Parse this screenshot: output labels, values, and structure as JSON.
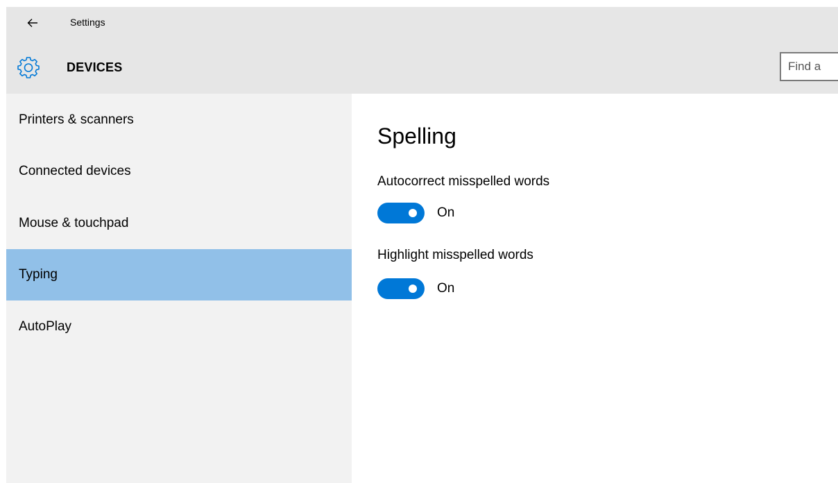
{
  "window": {
    "title": "Settings",
    "back_icon": "back-arrow-icon"
  },
  "header": {
    "icon": "gear-icon",
    "title": "DEVICES",
    "search": {
      "placeholder": "Find a",
      "value": ""
    }
  },
  "sidebar": {
    "items": [
      {
        "label": "Printers & scanners",
        "selected": false
      },
      {
        "label": "Connected devices",
        "selected": false
      },
      {
        "label": "Mouse & touchpad",
        "selected": false
      },
      {
        "label": "Typing",
        "selected": true
      },
      {
        "label": "AutoPlay",
        "selected": false
      }
    ]
  },
  "main": {
    "heading": "Spelling",
    "settings": [
      {
        "label": "Autocorrect misspelled words",
        "state": "On",
        "enabled": true
      },
      {
        "label": "Highlight misspelled words",
        "state": "On",
        "enabled": true
      }
    ]
  },
  "colors": {
    "chrome": "#e6e6e6",
    "sidebar": "#f2f2f2",
    "selected": "#91c0e8",
    "accent": "#0078d7"
  }
}
